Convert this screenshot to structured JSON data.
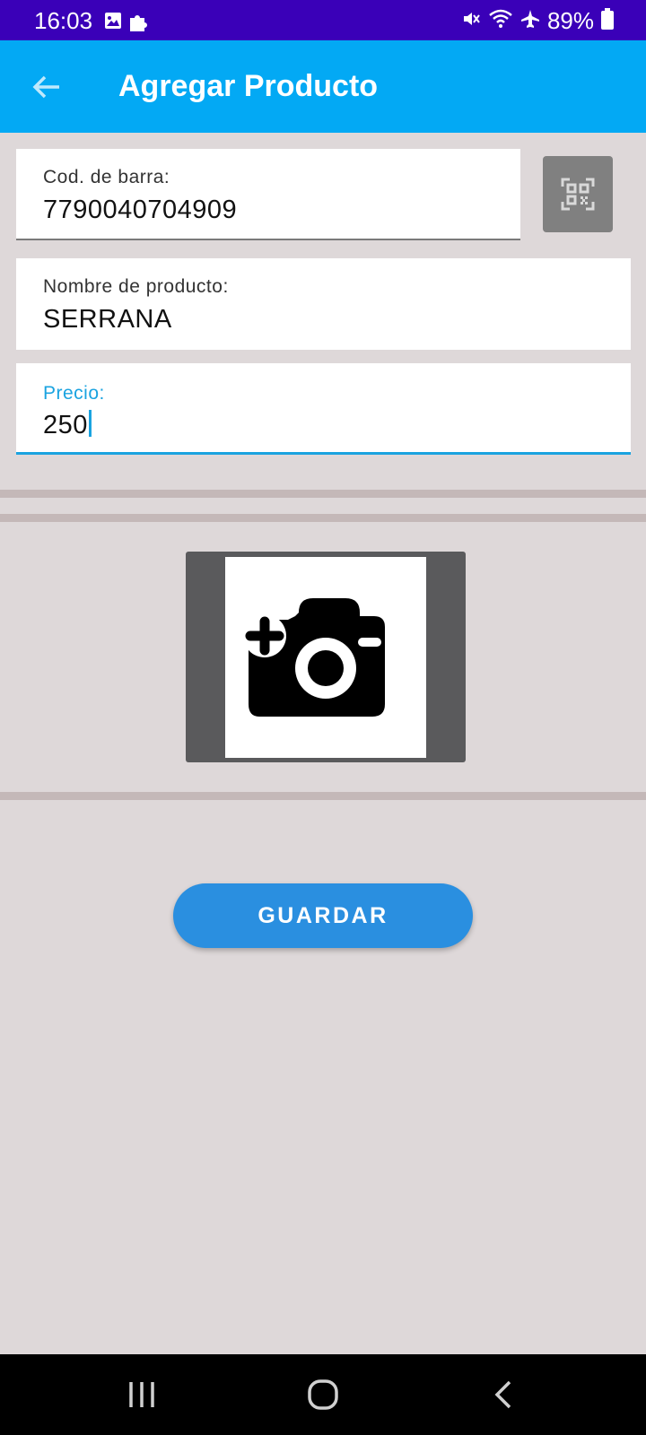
{
  "status_bar": {
    "time": "16:03",
    "battery": "89%",
    "icons": [
      "image-icon",
      "puzzle-icon",
      "mute-icon",
      "wifi-icon",
      "airplane-icon",
      "battery-icon"
    ]
  },
  "app_bar": {
    "title": "Agregar Producto",
    "back_icon": "arrow-left-icon"
  },
  "form": {
    "barcode": {
      "label": "Cod. de barra:",
      "value": "7790040704909"
    },
    "name": {
      "label": "Nombre de producto:",
      "value": "SERRANA"
    },
    "price": {
      "label": "Precio:",
      "value": "250"
    },
    "scan_icon": "qr-scan-icon"
  },
  "photo": {
    "icon": "add-camera-icon"
  },
  "actions": {
    "save_label": "GUARDAR"
  },
  "nav": {
    "icons": [
      "recents-icon",
      "home-icon",
      "back-icon"
    ]
  },
  "colors": {
    "status_bar": "#3a00b8",
    "app_bar": "#03a9f4",
    "background": "#ded8d9",
    "accent": "#1aa3e0",
    "save_button": "#2a8fe0"
  }
}
